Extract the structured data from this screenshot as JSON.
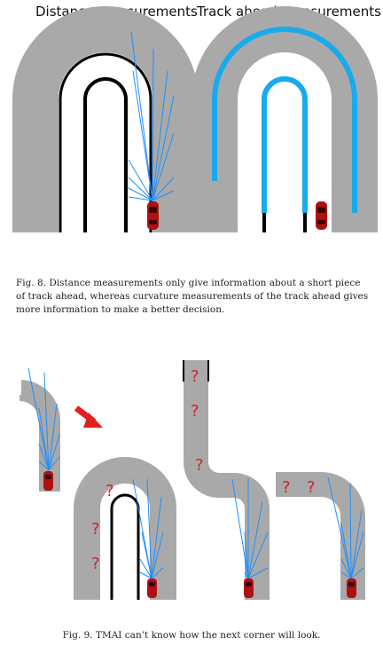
{
  "figure8": {
    "left_title": "Distance measurements",
    "right_title": "Track ahead measurements",
    "caption": "Fig. 8.  Distance measurements only give information about a short piece of track ahead, whereas curvature measurements of the track ahead gives more information to make a better decision."
  },
  "figure9": {
    "caption": "Fig. 9.  TMAI can’t know how the next corner will look.",
    "unknown_mark": "?"
  },
  "colors": {
    "track": "#a9a9a9",
    "border": "#000000",
    "ray": "#1e90ff",
    "track_ahead": "#18aaee",
    "car": "#b01010",
    "question": "#d42020",
    "arrow": "#e02020"
  }
}
